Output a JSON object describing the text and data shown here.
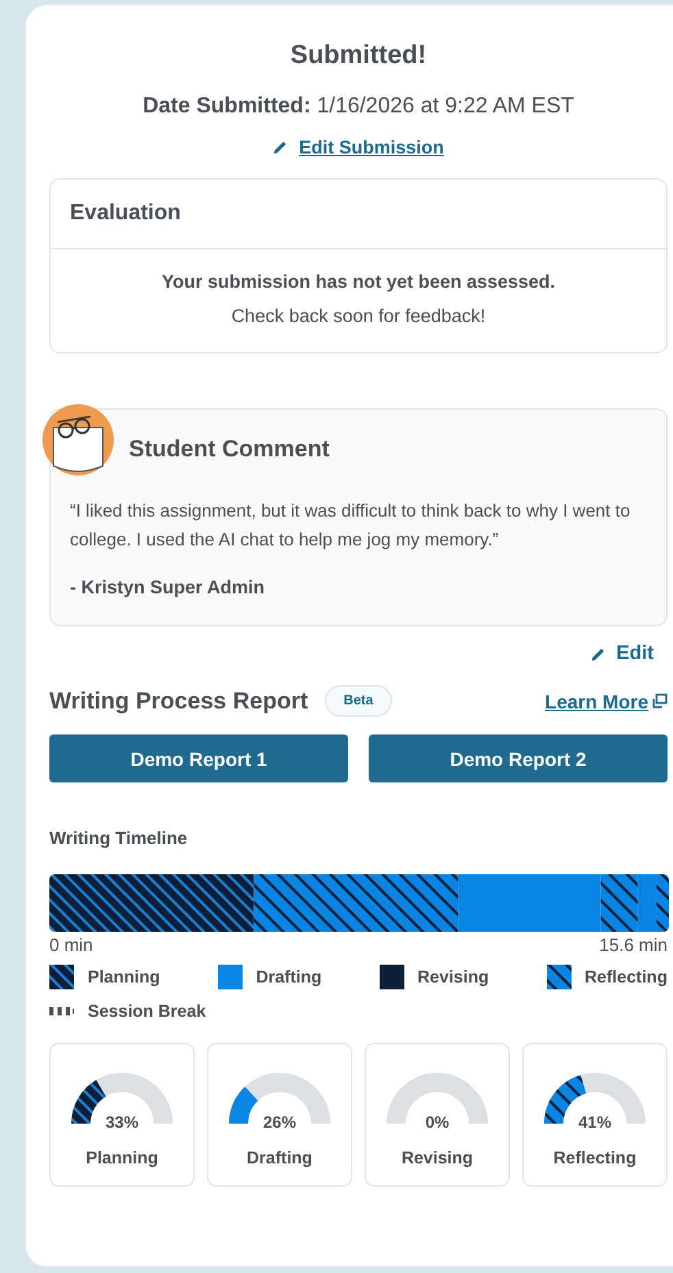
{
  "header": {
    "title": "Submitted!",
    "date_label": "Date Submitted:",
    "date_value": "1/16/2026 at 9:22 AM EST",
    "edit_link": "Edit Submission"
  },
  "evaluation": {
    "title": "Evaluation",
    "message": "Your submission has not yet been assessed.",
    "hint": "Check back soon for feedback!"
  },
  "student_comment": {
    "title": "Student Comment",
    "quote": "“I liked this assignment, but it was difficult to think back to why I went to college. I used the AI chat to help me jog my memory.”",
    "author": "- Kristyn Super Admin",
    "edit_link": "Edit"
  },
  "report": {
    "title": "Writing Process Report",
    "badge": "Beta",
    "learn_more": "Learn More",
    "buttons": [
      "Demo Report 1",
      "Demo Report 2"
    ],
    "timeline": {
      "title": "Writing Timeline",
      "start_label": "0 min",
      "end_label": "15.6 min",
      "segments": [
        {
          "kind": "planning"
        },
        {
          "kind": "reflecting"
        },
        {
          "kind": "drafting"
        },
        {
          "kind": "reflecting"
        },
        {
          "kind": "drafting"
        },
        {
          "kind": "reflecting"
        }
      ]
    },
    "legend": [
      {
        "kind": "planning",
        "label": "Planning"
      },
      {
        "kind": "drafting",
        "label": "Drafting"
      },
      {
        "kind": "revising",
        "label": "Revising"
      },
      {
        "kind": "reflecting",
        "label": "Reflecting"
      },
      {
        "kind": "session_break",
        "label": "Session Break"
      }
    ],
    "gauges": [
      {
        "percent": "33%",
        "label": "Planning"
      },
      {
        "percent": "26%",
        "label": "Drafting"
      },
      {
        "percent": "0%",
        "label": "Revising"
      },
      {
        "percent": "41%",
        "label": "Reflecting"
      }
    ]
  }
}
